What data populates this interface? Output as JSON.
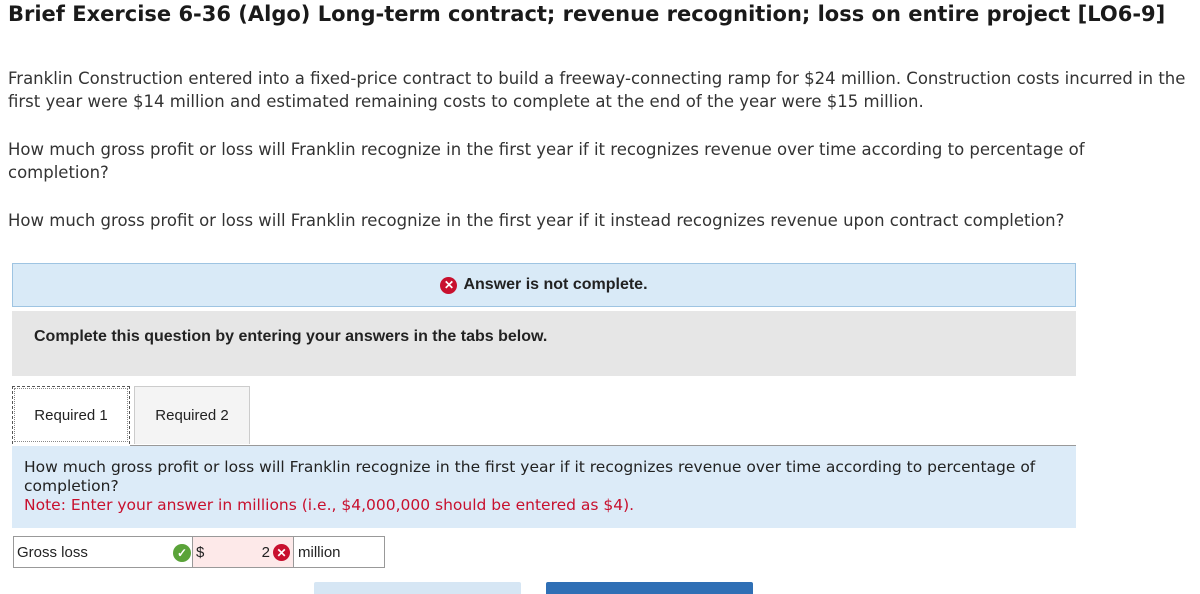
{
  "title": "Brief Exercise 6-36 (Algo) Long-term contract; revenue recognition; loss on entire project [LO6-9]",
  "paragraphs": {
    "p1": "Franklin Construction entered into a fixed-price contract to build a freeway-connecting ramp for $24 million. Construction costs incurred in the first year were $14 million and estimated remaining costs to complete at the end of the year were $15 million.",
    "p2": "How much gross profit or loss will Franklin recognize in the first year if it recognizes revenue over time according to percentage of completion?",
    "p3": "How much gross profit or loss will Franklin recognize in the first year if it instead recognizes revenue upon contract completion?"
  },
  "banner": {
    "icon": "x-circle-icon",
    "icon_glyph": "✕",
    "text": "Answer is not complete."
  },
  "instruction": "Complete this question by entering your answers in the tabs below.",
  "tabs": [
    {
      "label": "Required 1",
      "active": true
    },
    {
      "label": "Required 2",
      "active": false
    }
  ],
  "question": {
    "text": "How much gross profit or loss will Franklin recognize in the first year if it recognizes revenue over time according to percentage of completion?",
    "note": "Note: Enter your answer in millions (i.e., $4,000,000 should be entered as $4)."
  },
  "answer": {
    "label": "Gross loss",
    "label_status_glyph": "✓",
    "currency": "$",
    "value": "2",
    "value_status_glyph": "✕",
    "unit": "million"
  },
  "colors": {
    "error": "#c8102e",
    "correct": "#5aa339",
    "banner_bg": "#d9eaf7",
    "primary_button": "#2f6fb5"
  }
}
